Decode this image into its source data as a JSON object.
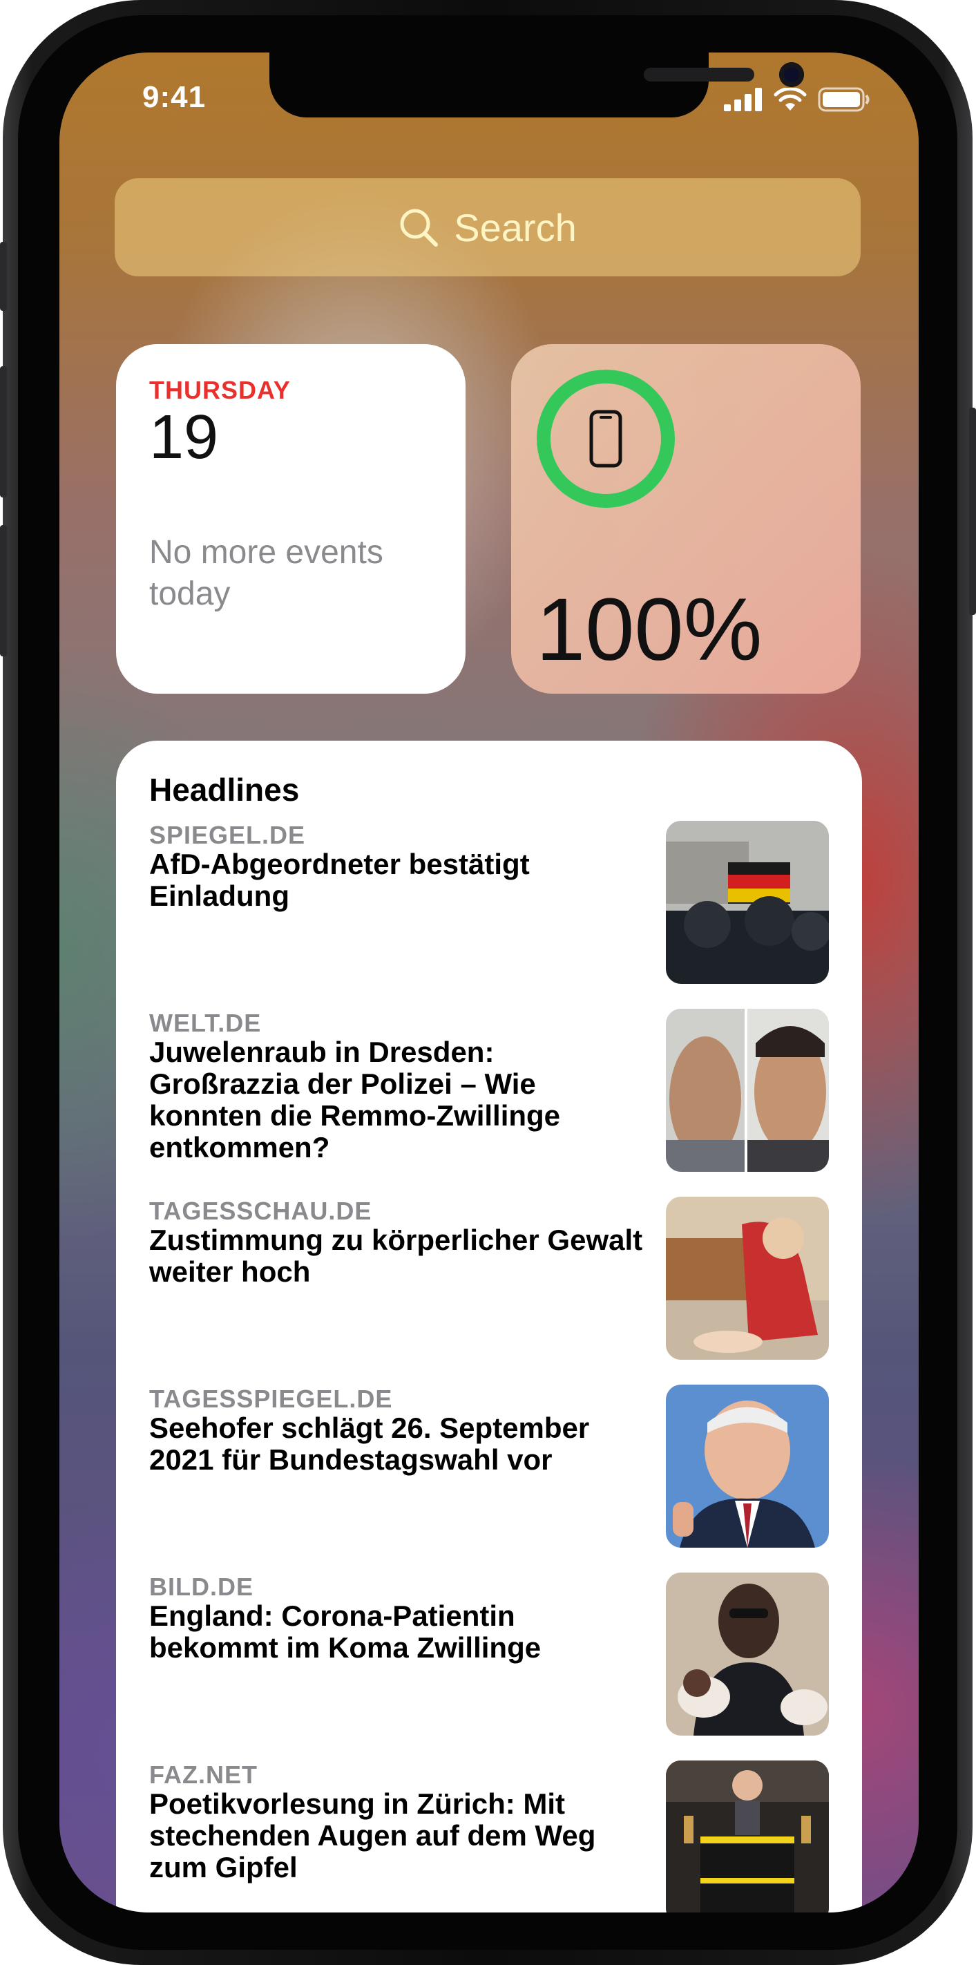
{
  "status_bar": {
    "time": "9:41",
    "icons": [
      "cellular-signal-icon",
      "wifi-icon",
      "battery-icon"
    ]
  },
  "search": {
    "label": "Search",
    "icon": "search-icon"
  },
  "calendar_widget": {
    "weekday": "THURSDAY",
    "date": "19",
    "note": "No more events today"
  },
  "battery_widget": {
    "level_percent": 100,
    "label": "100%",
    "icon": "iphone-icon",
    "ring_color": "#34c759"
  },
  "headlines_widget": {
    "title": "Headlines",
    "items": [
      {
        "source": "SPIEGEL.DE",
        "headline": "AfD-Abgeordneter bestätigt Einladung"
      },
      {
        "source": "WELT.DE",
        "headline": "Juwelenraub in Dresden: Großrazzia der Polizei – Wie konnten die Remmo-Zwillinge entkommen?"
      },
      {
        "source": "TAGESSCHAU.DE",
        "headline": "Zustimmung zu körperlicher Gewalt weiter hoch"
      },
      {
        "source": "TAGESSPIEGEL.DE",
        "headline": "Seehofer schlägt 26. September 2021 für Bundestagswahl vor"
      },
      {
        "source": "BILD.DE",
        "headline": "England: Corona-Patientin bekommt im Koma Zwillinge"
      },
      {
        "source": "FAZ.NET",
        "headline": "Poetikvorlesung in Zürich: Mit stechenden Augen auf dem Weg zum Gipfel"
      }
    ]
  },
  "colors": {
    "calendar_red": "#e8302d",
    "battery_green": "#34c759"
  }
}
